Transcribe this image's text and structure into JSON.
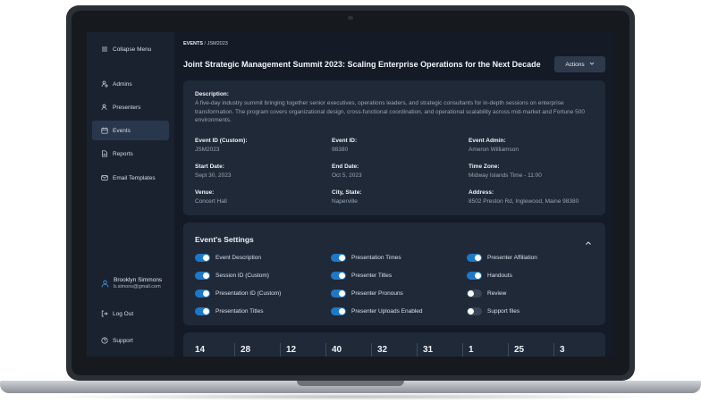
{
  "sidebar": {
    "collapse_label": "Collapse Menu",
    "items": [
      {
        "label": "Admins",
        "icon": "user-gear-icon"
      },
      {
        "label": "Presenters",
        "icon": "presenter-icon"
      },
      {
        "label": "Events",
        "icon": "calendar-icon"
      },
      {
        "label": "Reports",
        "icon": "document-icon"
      },
      {
        "label": "Email Templates",
        "icon": "email-icon"
      }
    ],
    "active": "Events",
    "user": {
      "name": "Brooklyn Simmons",
      "email": "b.simons@gmail.com"
    },
    "logout_label": "Log Out",
    "support_label": "Support"
  },
  "breadcrumb": {
    "root": "EVENTS",
    "separator": " / ",
    "current": "JSM2023"
  },
  "page_title": "Joint Strategic Management Summit 2023: Scaling Enterprise Operations for the Next Decade",
  "actions_label": "Actions",
  "details": {
    "description_label": "Description:",
    "description": "A five-day industry summit bringing together senior executives, operations leaders, and strategic consultants for in-depth sessions on enterprise transformation. The program covers organizational design, cross-functional coordination, and operational scalability across mid-market and Fortune 500 environments.",
    "fields": [
      {
        "label": "Event ID (Custom):",
        "value": "JSM2023"
      },
      {
        "label": "Event ID:",
        "value": "98380"
      },
      {
        "label": "Event Admin:",
        "value": "Ameron Williamson"
      },
      {
        "label": "Start Date:",
        "value": "Sept 30, 2023"
      },
      {
        "label": "End Date:",
        "value": "Oct 5, 2023"
      },
      {
        "label": "Time Zone:",
        "value": "Midway Islands Time - 11:00"
      },
      {
        "label": "Venue:",
        "value": "Concert Hall"
      },
      {
        "label": "City, State:",
        "value": "Naperville"
      },
      {
        "label": "Address:",
        "value": "8502 Preston Rd, Inglewood, Maine 98380"
      }
    ]
  },
  "settings": {
    "title": "Event's Settings",
    "toggles": [
      {
        "label": "Event Description",
        "on": true
      },
      {
        "label": "Presentation Times",
        "on": true
      },
      {
        "label": "Presenter Affiliation",
        "on": true
      },
      {
        "label": "Session ID (Custom)",
        "on": true
      },
      {
        "label": "Presenter Titles",
        "on": true
      },
      {
        "label": "Handouts",
        "on": true
      },
      {
        "label": "Presentation ID (Custom)",
        "on": true
      },
      {
        "label": "Presenter Pronouns",
        "on": true
      },
      {
        "label": "Review",
        "on": false
      },
      {
        "label": "Presentation Titles",
        "on": true
      },
      {
        "label": "Presenter Uploads Enabled",
        "on": true
      },
      {
        "label": "Support files",
        "on": false
      }
    ]
  },
  "stats": [
    "14",
    "28",
    "12",
    "40",
    "32",
    "31",
    "1",
    "25",
    "3"
  ],
  "colors": {
    "accent": "#1d78c9",
    "sidebar": "#1a2230",
    "card": "#1f2938",
    "background": "#141b26"
  }
}
